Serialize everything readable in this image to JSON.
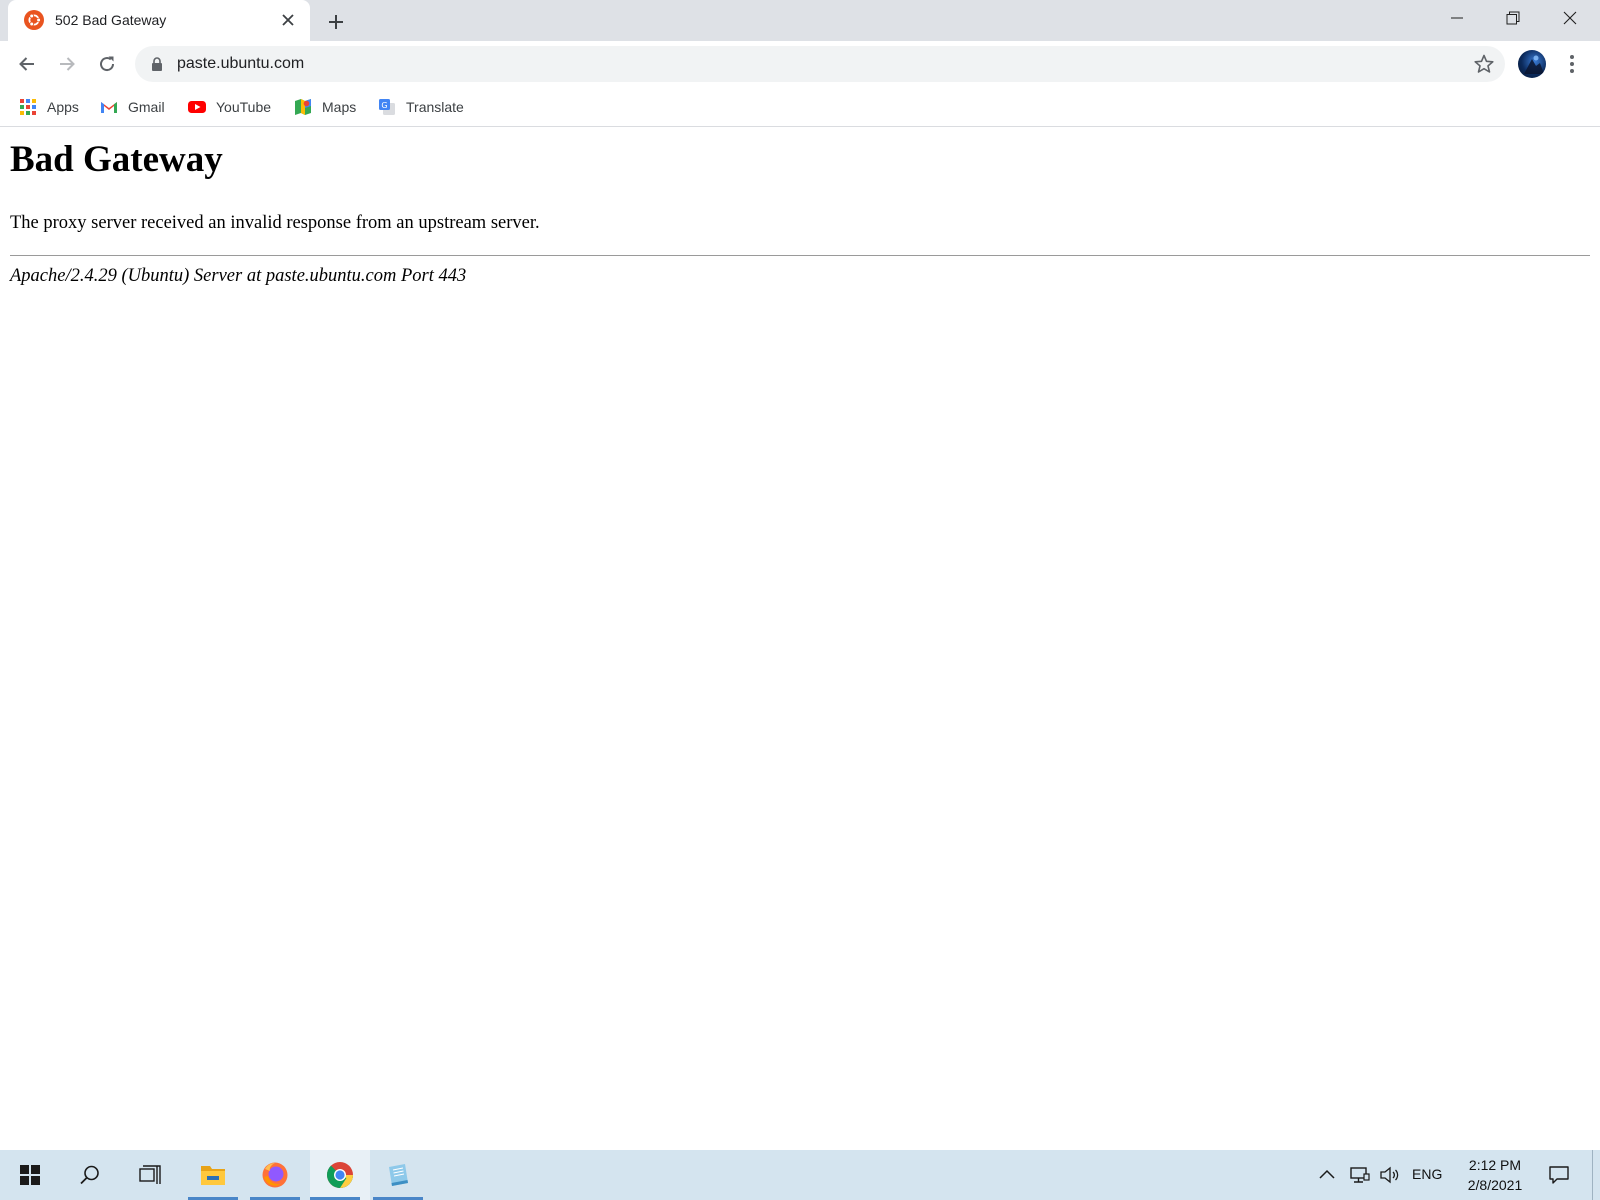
{
  "browser": {
    "tab": {
      "title": "502 Bad Gateway",
      "favicon": "ubuntu-logo-icon"
    },
    "new_tab_icon": "plus-icon",
    "window_controls": [
      "minimize-icon",
      "restore-icon",
      "close-icon"
    ],
    "omnibox": {
      "url": "paste.ubuntu.com",
      "secure_icon": "lock-icon"
    },
    "bookmarks": [
      {
        "label": "Apps",
        "icon": "apps-grid-icon"
      },
      {
        "label": "Gmail",
        "icon": "gmail-icon"
      },
      {
        "label": "YouTube",
        "icon": "youtube-icon"
      },
      {
        "label": "Maps",
        "icon": "maps-icon"
      },
      {
        "label": "Translate",
        "icon": "translate-icon"
      }
    ]
  },
  "page": {
    "heading": "Bad Gateway",
    "message": "The proxy server received an invalid response from an upstream server.",
    "address": "Apache/2.4.29 (Ubuntu) Server at paste.ubuntu.com Port 443"
  },
  "taskbar": {
    "apps": [
      "file-explorer-icon",
      "firefox-icon",
      "chrome-icon",
      "notepad-icon"
    ],
    "language": "ENG",
    "time": "2:12 PM",
    "date": "2/8/2021"
  },
  "colors": {
    "tabstrip_bg": "#dee1e6",
    "omnibox_bg": "#f1f3f4",
    "taskbar_bg": "#d4e4ef",
    "ubuntu_orange": "#e95420"
  }
}
